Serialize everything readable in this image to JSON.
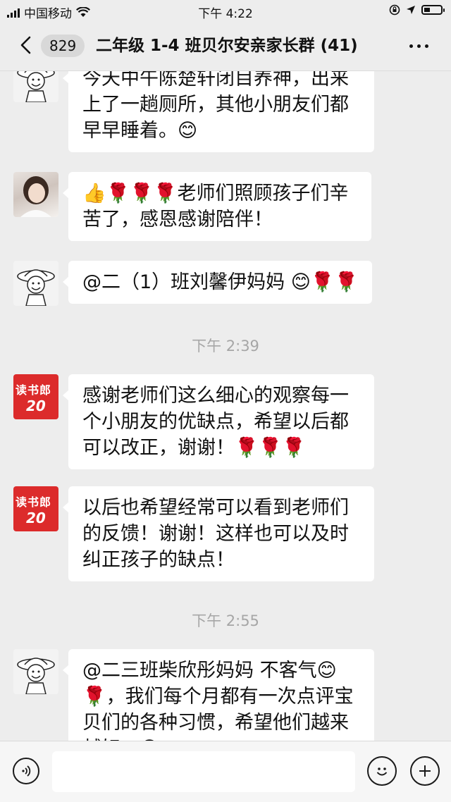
{
  "status_bar": {
    "carrier": "中国移动",
    "time": "下午 4:22"
  },
  "nav": {
    "unread_count": "829",
    "title": "二年级 1-4 班贝尔安亲家长群 (41)"
  },
  "messages": [
    {
      "avatar": "luffy-avatar",
      "text": "今天中午陈楚轩闭目养神，出来上了一趟厕所，其他小朋友们都早早睡着。😊"
    },
    {
      "avatar": "photo-avatar",
      "text": "👍🌹🌹🌹老师们照顾孩子们辛苦了，感恩感谢陪伴！"
    },
    {
      "avatar": "luffy-avatar",
      "text": "@二（1）班刘馨伊妈妈 😊🌹🌹"
    },
    {
      "timestamp": "下午 2:39"
    },
    {
      "avatar": "brand-avatar",
      "brand_name": "读书郎",
      "brand_num": "20",
      "text": "感谢老师们这么细心的观察每一个小朋友的优缺点，希望以后都可以改正，谢谢！🌹🌹🌹"
    },
    {
      "avatar": "brand-avatar",
      "brand_name": "读书郎",
      "brand_num": "20",
      "text": "以后也希望经常可以看到老师们的反馈！谢谢！这样也可以及时纠正孩子的缺点！"
    },
    {
      "timestamp": "下午 2:55"
    },
    {
      "avatar": "luffy-avatar",
      "text": "@二三班柴欣彤妈妈 不客气😊🌹，我们每个月都有一次点评宝贝们的各种习惯，希望他们越来越好。😊"
    }
  ],
  "input_bar": {
    "voice_icon": "voice-icon",
    "emoji_icon": "emoji-icon",
    "plus_icon": "plus-icon"
  }
}
